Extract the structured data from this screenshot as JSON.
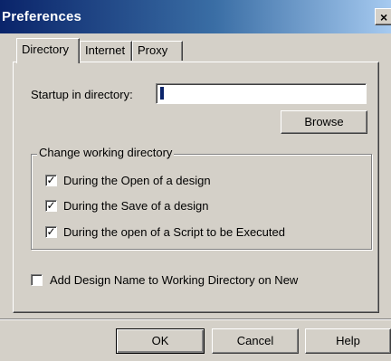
{
  "window": {
    "title": "Preferences",
    "close_glyph": "×"
  },
  "tabs": [
    {
      "label": "Directory",
      "active": true
    },
    {
      "label": "Internet",
      "active": false
    },
    {
      "label": "Proxy",
      "active": false
    }
  ],
  "directory": {
    "startup_label": "Startup in directory:",
    "startup_value": "",
    "browse_label": "Browse"
  },
  "change_group": {
    "legend": "Change working directory",
    "options": [
      {
        "label": "During the Open of a design",
        "checked": true
      },
      {
        "label": "During the Save of a design",
        "checked": true
      },
      {
        "label": "During the open of a Script to be Executed",
        "checked": true
      }
    ]
  },
  "add_design": {
    "label": "Add Design Name to Working Directory on New",
    "checked": false
  },
  "footer": {
    "ok_label": "OK",
    "cancel_label": "Cancel",
    "help_label": "Help"
  },
  "check_glyph": "✓"
}
